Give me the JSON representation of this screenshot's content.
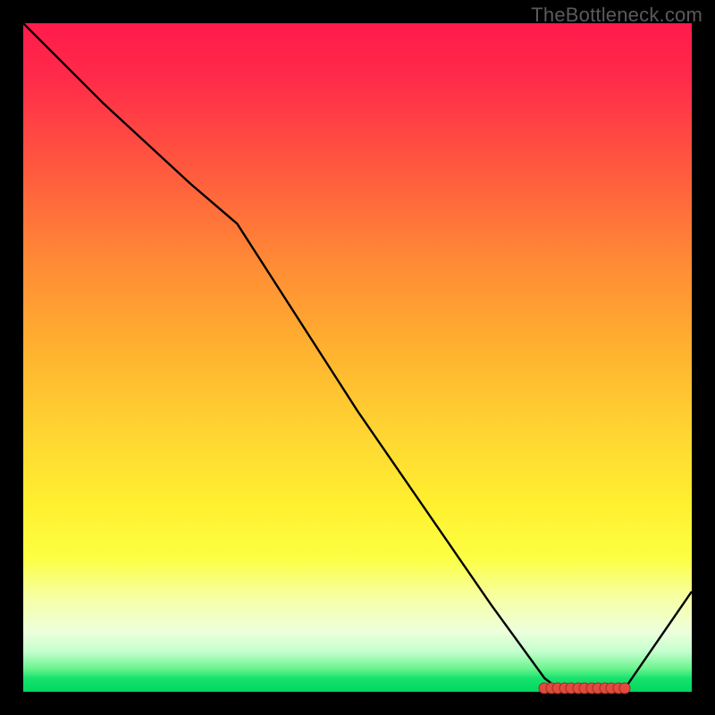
{
  "watermark": "TheBottleneck.com",
  "colors": {
    "frame": "#000000",
    "curve": "#000000",
    "marker": "#e24a3d"
  },
  "chart_data": {
    "type": "line",
    "title": "",
    "xlabel": "",
    "ylabel": "",
    "xlim": [
      0,
      100
    ],
    "ylim": [
      0,
      100
    ],
    "grid": false,
    "series": [
      {
        "name": "bottleneck-curve",
        "x": [
          0,
          12,
          25,
          32,
          50,
          70,
          78,
          80,
          82,
          84,
          86,
          88,
          90,
          100
        ],
        "values": [
          100,
          88,
          76,
          70,
          42,
          13,
          2,
          0.5,
          0.5,
          0.5,
          0.5,
          0.5,
          0.5,
          15
        ]
      }
    ],
    "markers": {
      "name": "optimal-range",
      "x": [
        78,
        79,
        80,
        81,
        82,
        83,
        84,
        85,
        86,
        87,
        88,
        89,
        90
      ],
      "values": [
        0.5,
        0.5,
        0.5,
        0.5,
        0.5,
        0.5,
        0.5,
        0.5,
        0.5,
        0.5,
        0.5,
        0.5,
        0.5
      ]
    }
  }
}
